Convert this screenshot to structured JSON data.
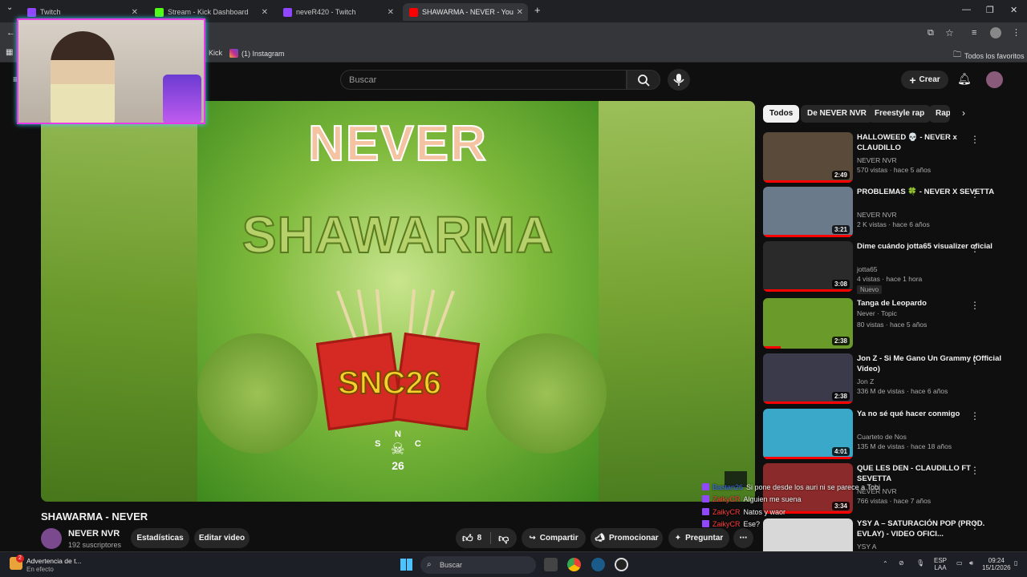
{
  "browser": {
    "tabs": [
      {
        "label": "Twitch",
        "color": "#9146ff"
      },
      {
        "label": "Stream - Kick Dashboard",
        "color": "#53fc18"
      },
      {
        "label": "neveR420 - Twitch",
        "color": "#9146ff"
      },
      {
        "label": "SHAWARMA - NEVER - You",
        "color": "#ff0000"
      }
    ],
    "new_tab": "+",
    "bookmarks": [
      {
        "label": "Kick"
      },
      {
        "label": "(1) Instagram"
      }
    ],
    "all_bookmarks": "Todos los favoritos"
  },
  "youtube": {
    "search_placeholder": "Buscar",
    "create_label": "Crear",
    "video": {
      "cover_top": "NEVER",
      "cover_title": "SHAWARMA",
      "cover_logo": "SNC26",
      "cover_skull_labels": [
        "N",
        "S",
        "C",
        "26"
      ],
      "title": "SHAWARMA - NEVER",
      "channel": "NEVER NVR",
      "subscribers": "192 suscriptores",
      "stats_button": "Estadísticas",
      "edit_button": "Editar video",
      "likes": "8",
      "share": "Compartir",
      "promote": "Promocionar",
      "ask": "Preguntar"
    },
    "chips": [
      "Todos",
      "De NEVER NVR",
      "Freestyle rap",
      "Rap"
    ],
    "recommendations": [
      {
        "title": "HALLOWEED 💀 - NEVER x CLAUDILLO",
        "channel": "NEVER NVR",
        "meta": "570 vistas · hace 5 años",
        "duration": "2:49",
        "thumb": "#5a4a3a"
      },
      {
        "title": "PROBLEMAS 🍀 - NEVER X SEVETTA",
        "channel": "NEVER NVR",
        "meta": "2 K vistas · hace 6 años",
        "duration": "3:21",
        "thumb": "#6a7a8a"
      },
      {
        "title": "Dime cuándo  jotta65 visualizer oficial",
        "channel": "jotta65",
        "meta": "4 vistas · hace 1 hora",
        "duration": "3:08",
        "thumb": "#2a2a2a",
        "badge": "Nuevo"
      },
      {
        "title": "Tanga de Leopardo",
        "channel": "Never · Topic",
        "meta": "80 vistas · hace 5 años",
        "duration": "2:38",
        "thumb": "#6a9a2a"
      },
      {
        "title": "Jon Z - Si Me Gano Un Grammy (Official Video)",
        "channel": "Jon Z",
        "meta": "336 M de vistas · hace 6 años",
        "duration": "2:38",
        "thumb": "#3a3a4a"
      },
      {
        "title": "Ya no sé qué hacer conmigo",
        "channel": "Cuarteto de Nos",
        "meta": "135 M de vistas · hace 18 años",
        "duration": "4:01",
        "thumb": "#3aa8c8"
      },
      {
        "title": "QUE LES DEN - CLAUDILLO FT SEVETTA",
        "channel": "NEVER NVR",
        "meta": "766 vistas · hace 7 años",
        "duration": "3:34",
        "thumb": "#8a2a2a"
      },
      {
        "title": "YSY A – SATURACIÓN POP (PROD. EVLAY) - VIDEO OFICI...",
        "channel": "YSY A",
        "meta": "",
        "duration": "",
        "thumb": "#d8d8d8"
      }
    ]
  },
  "chat": [
    {
      "user": "Bastan26",
      "color": "#3b6cff",
      "msg": "Si pone desde los auri ni se parece a Tobi"
    },
    {
      "user": "ZaikyCR",
      "color": "#ff3b3b",
      "msg": "Alguien me suena"
    },
    {
      "user": "ZaikyCR",
      "color": "#ff3b3b",
      "msg": "Natos y waor"
    },
    {
      "user": "ZaikyCR",
      "color": "#ff3b3b",
      "msg": "Ese?"
    }
  ],
  "taskbar": {
    "notification_title": "Advertencia de t...",
    "notification_sub": "En efecto",
    "notification_count": "2",
    "search": "Buscar",
    "lang_top": "ESP",
    "lang_bottom": "LAA",
    "time": "09:24",
    "date": "15/1/2026"
  }
}
